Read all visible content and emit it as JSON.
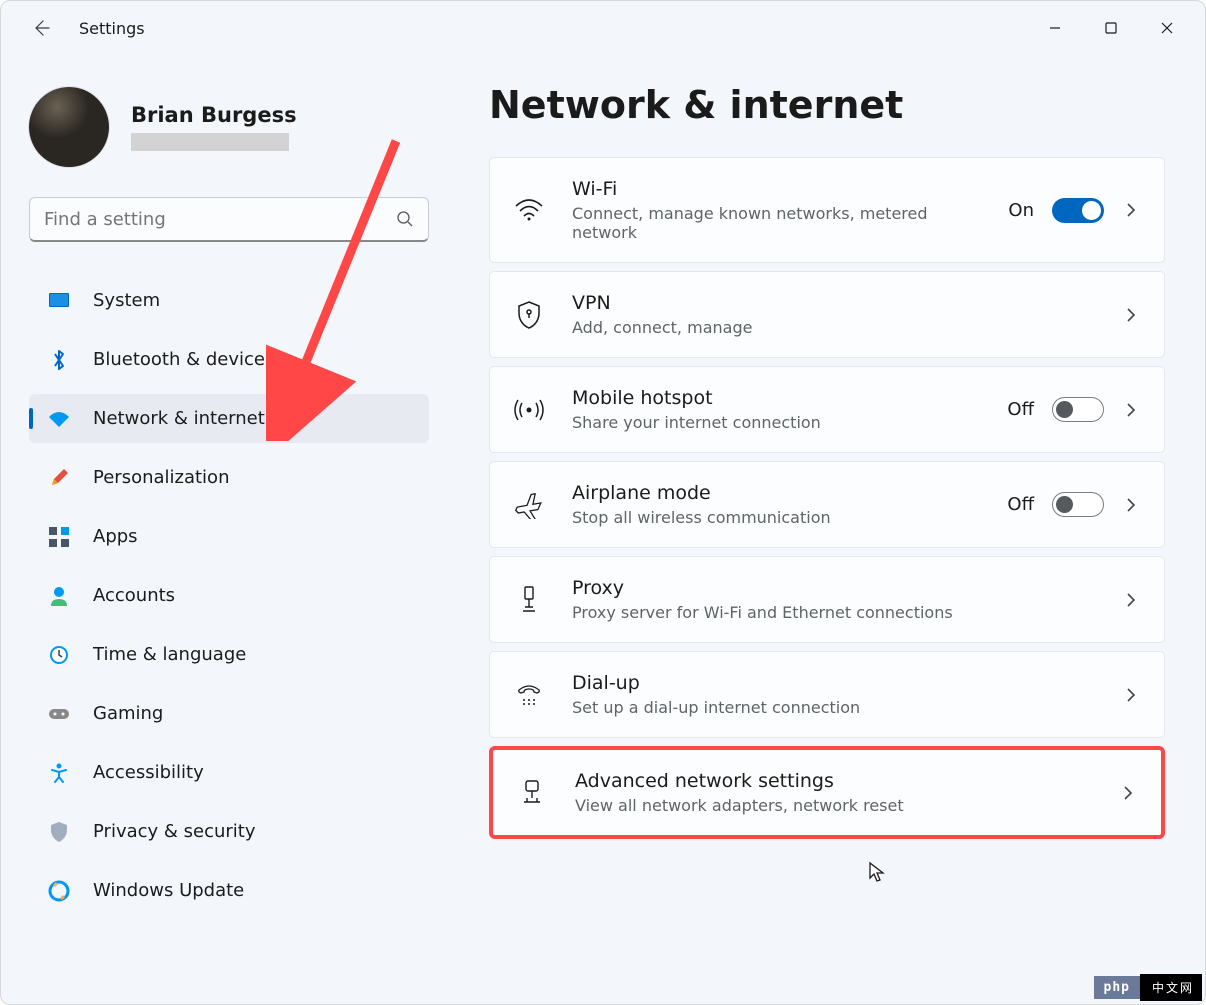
{
  "window": {
    "title": "Settings"
  },
  "user": {
    "name": "Brian Burgess"
  },
  "search": {
    "placeholder": "Find a setting"
  },
  "sidebar": {
    "items": [
      {
        "label": "System"
      },
      {
        "label": "Bluetooth & devices"
      },
      {
        "label": "Network & internet"
      },
      {
        "label": "Personalization"
      },
      {
        "label": "Apps"
      },
      {
        "label": "Accounts"
      },
      {
        "label": "Time & language"
      },
      {
        "label": "Gaming"
      },
      {
        "label": "Accessibility"
      },
      {
        "label": "Privacy & security"
      },
      {
        "label": "Windows Update"
      }
    ],
    "selected_index": 2
  },
  "page": {
    "title": "Network & internet"
  },
  "cards": {
    "wifi": {
      "title": "Wi-Fi",
      "sub": "Connect, manage known networks, metered network",
      "toggle_label": "On",
      "toggle_on": true
    },
    "vpn": {
      "title": "VPN",
      "sub": "Add, connect, manage"
    },
    "hotspot": {
      "title": "Mobile hotspot",
      "sub": "Share your internet connection",
      "toggle_label": "Off",
      "toggle_on": false
    },
    "airplane": {
      "title": "Airplane mode",
      "sub": "Stop all wireless communication",
      "toggle_label": "Off",
      "toggle_on": false
    },
    "proxy": {
      "title": "Proxy",
      "sub": "Proxy server for Wi-Fi and Ethernet connections"
    },
    "dialup": {
      "title": "Dial-up",
      "sub": "Set up a dial-up internet connection"
    },
    "advanced": {
      "title": "Advanced network settings",
      "sub": "View all network adapters, network reset"
    }
  },
  "badge": {
    "php": "php",
    "cn": "中文网"
  },
  "colors": {
    "accent": "#0067c0",
    "annot": "#fe4746"
  }
}
